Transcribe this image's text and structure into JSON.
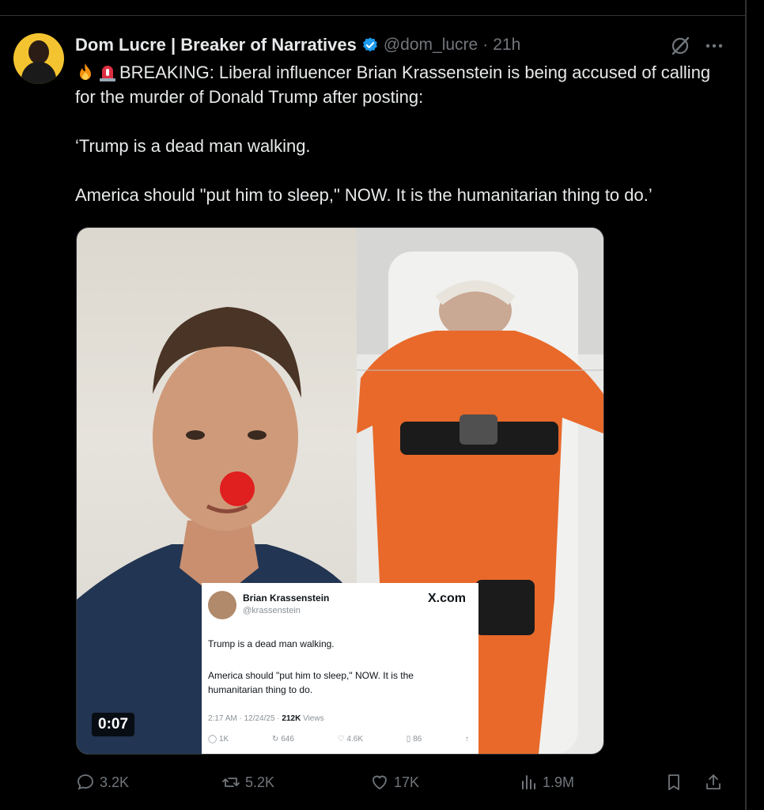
{
  "tweet": {
    "author_name": "Dom Lucre | Breaker of Narratives",
    "author_handle": "@dom_lucre",
    "separator": "·",
    "time": "21h",
    "icons": {
      "verified": "verified-badge-icon",
      "grok": "grok-icon",
      "more": "more-icon",
      "fire": "fire-emoji-icon",
      "siren": "siren-emoji-icon"
    },
    "text_line1": "BREAKING: Liberal influencer Brian Krassenstein is being accused of calling for the murder of Donald Trump after posting:",
    "text_line2": "‘Trump is a dead man walking.",
    "text_line3": "America should \"put him to sleep,\" NOW. It is the humanitarian thing to do.’"
  },
  "media": {
    "duration": "0:07",
    "embed": {
      "name": "Brian Krassenstein",
      "handle": "@krassenstein",
      "site": "X.com",
      "line1": "Trump is a dead man walking.",
      "line2": "America should \"put him to sleep,\" NOW.  It is the humanitarian thing to do.",
      "meta_prefix": "2:17 AM · 12/24/25 · ",
      "views_count": "212K",
      "views_label": " Views",
      "replies": "1K",
      "reposts": "646",
      "likes": "4.6K",
      "bookmarks": "86"
    }
  },
  "actions": {
    "replies": "3.2K",
    "reposts": "5.2K",
    "likes": "17K",
    "views": "1.9M"
  },
  "colors": {
    "background": "#000000",
    "text": "#e7e9ea",
    "muted": "#71767b",
    "verified": "#1d9bf0",
    "jumpsuit": "#e8692a",
    "red_nose": "#e01f1f"
  }
}
